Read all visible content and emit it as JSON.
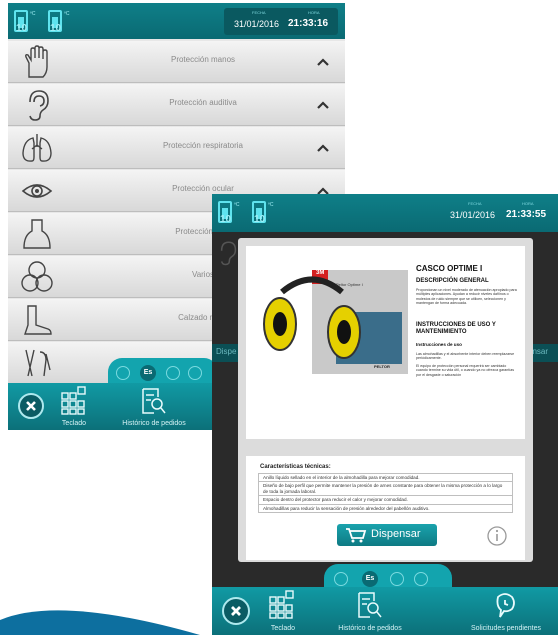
{
  "screen_back": {
    "meter1": {
      "sup": "ºC",
      "value": "10"
    },
    "meter2": {
      "sup": "ºC",
      "value": "10"
    },
    "clock": {
      "date_label": "FECHA",
      "date": "31/01/2016",
      "time_label": "HORA",
      "time": "21:33:16"
    },
    "categories": [
      {
        "label": "Protección manos",
        "icon": "glove-icon"
      },
      {
        "label": "Protección auditiva",
        "icon": "ear-icon"
      },
      {
        "label": "Protección respiratoria",
        "icon": "lungs-icon"
      },
      {
        "label": "Protección ocular",
        "icon": "eye-icon"
      },
      {
        "label": "Protección corp",
        "icon": "body-icon"
      },
      {
        "label": "Varios",
        "icon": "circles-icon"
      },
      {
        "label": "Calzado norm",
        "icon": "boot-icon"
      },
      {
        "label": "",
        "icon": "harness-icon"
      }
    ],
    "lang": {
      "active": "Es"
    },
    "toolbar": {
      "keyboard_label": "Teclado",
      "history_label": "Histórico de pedidos"
    }
  },
  "screen_front": {
    "meter1": {
      "sup": "ºC",
      "value": "10"
    },
    "meter2": {
      "sup": "ºC",
      "value": "10"
    },
    "clock": {
      "date_label": "FECHA",
      "date": "31/01/2016",
      "time_label": "HORA",
      "time": "21:33:55"
    },
    "bg_left_label": "Dispe",
    "bg_right_label": "Dispensar",
    "product": {
      "title": "CASCO OPTIME I",
      "desc_heading": "DESCRIPCIÓN GENERAL",
      "desc_text": "Proporcionan un nivel moderado de atenuación apropiado para múltiples aplicaciones. Ayudan a reducir niveles dañinos o molestos de ruido siempre que se utilicen, seleccionen y mantengan de forma adecuada.",
      "instr_heading": "INSTRUCCIONES DE USO Y MANTENIMIENTO",
      "instr_sub": "Instrucciones de uso",
      "instr_text1": "Las almohadillas y el absorbente interior deben reemplazarse periódicamente.",
      "instr_text2": "El equipo de protección personal requerirá ser cambiado cuando termine su vida útil, o cuando ya no ofrezca garantías por el desgaste o saturación",
      "box_brand": "3M",
      "box_name": "Peltor Optime I",
      "box_footer": "PELTOR",
      "features_title": "Características técnicas:",
      "features": [
        "Anillo líquido sellado en el interior de la almohadilla para mejorar comodidad.",
        "Diseño de bajo perfil que permite mantener la presión de arnes constante para obtener la misma protección a lo largo de toda la jornada laboral.",
        "Espacio dentro del protector para reducir el calor y mejorar comodidad.",
        "Almohadillas para reducir la sensación de presión alrededor del pabellón auditivo."
      ]
    },
    "dispense_label": "Dispensar",
    "lang": {
      "active": "Es"
    },
    "toolbar": {
      "keyboard_label": "Teclado",
      "history_label": "Histórico de pedidos",
      "requests_label": "Solicitudes pendientes"
    }
  },
  "colors": {
    "teal": "#0f7f88",
    "teal_light": "#13a4ae",
    "cyan_accent": "#5fe3ee"
  }
}
